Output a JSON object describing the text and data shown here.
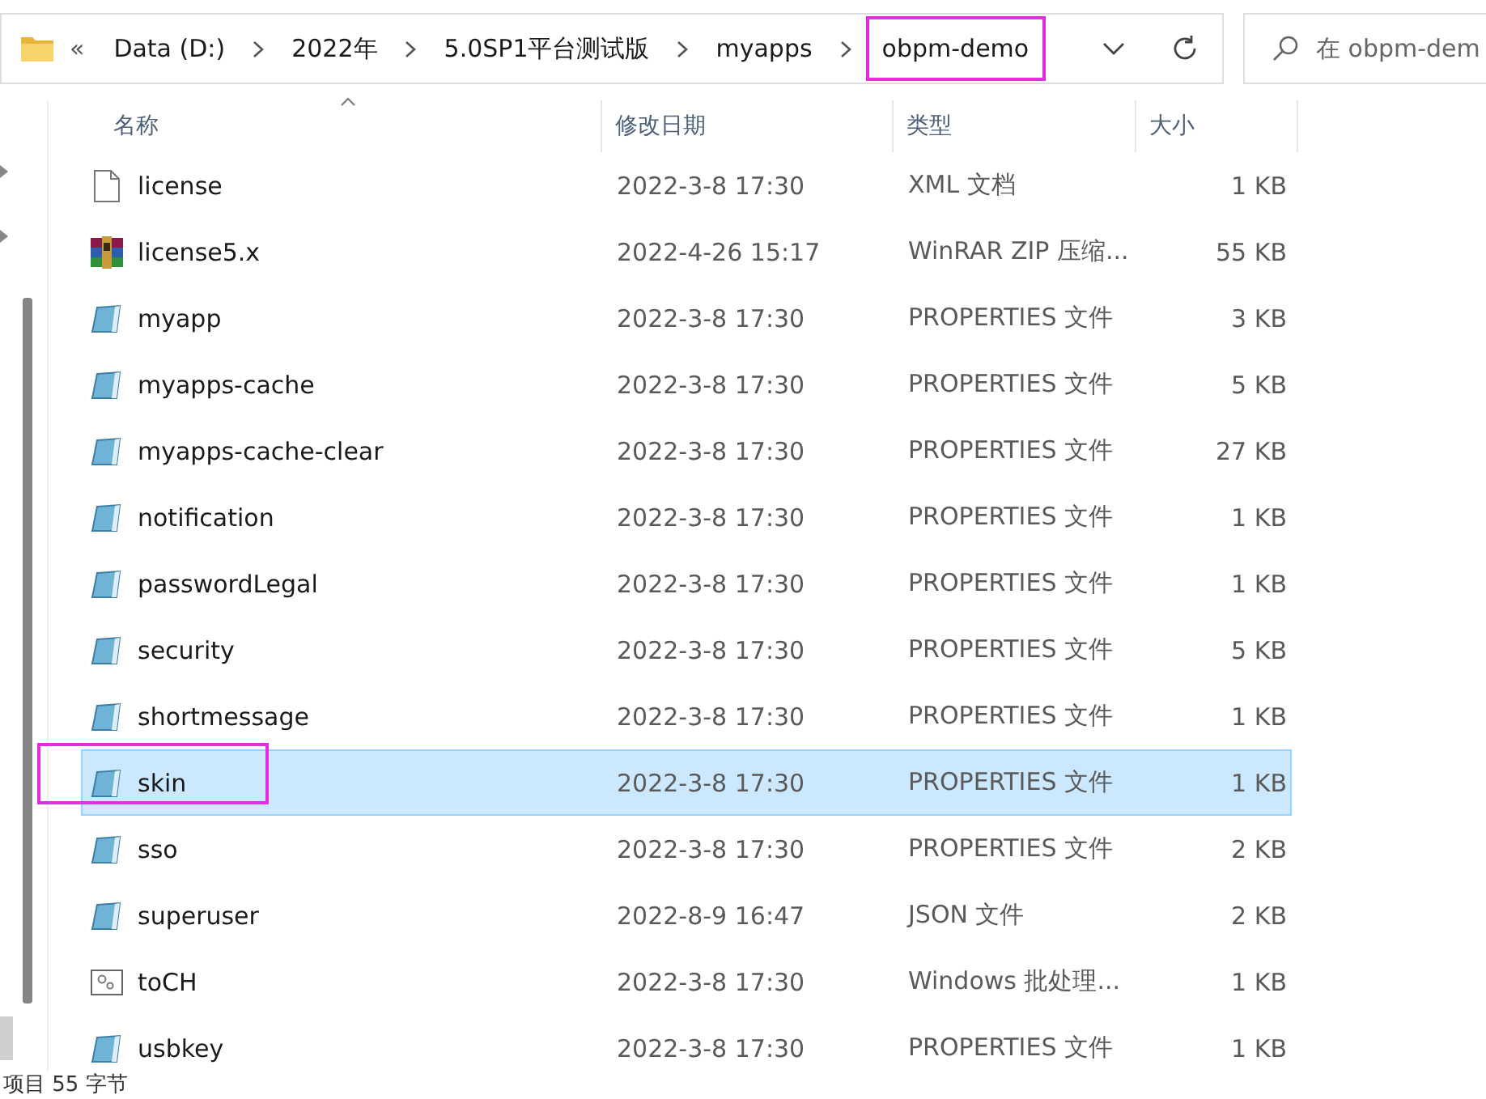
{
  "address_bar": {
    "overflow": "«",
    "path": [
      {
        "label": "Data (D:)",
        "highlighted": false
      },
      {
        "label": "2022年",
        "highlighted": false
      },
      {
        "label": "5.0SP1平台测试版",
        "highlighted": false
      },
      {
        "label": "myapps",
        "highlighted": false
      },
      {
        "label": "obpm-demo",
        "highlighted": true
      }
    ]
  },
  "search": {
    "placeholder": "在 obpm-dem"
  },
  "table": {
    "columns": [
      "名称",
      "修改日期",
      "类型",
      "大小"
    ],
    "rows": [
      {
        "kind": "file",
        "name": "license",
        "date": "2022-3-8 17:30",
        "type": "XML 文档",
        "size": "1 KB",
        "selected": false,
        "highlighted": false
      },
      {
        "kind": "archive",
        "name": "license5.x",
        "date": "2022-4-26 15:17",
        "type": "WinRAR ZIP 压缩...",
        "size": "55 KB",
        "selected": false,
        "highlighted": false
      },
      {
        "kind": "properties",
        "name": "myapp",
        "date": "2022-3-8 17:30",
        "type": "PROPERTIES 文件",
        "size": "3 KB",
        "selected": false,
        "highlighted": false
      },
      {
        "kind": "properties",
        "name": "myapps-cache",
        "date": "2022-3-8 17:30",
        "type": "PROPERTIES 文件",
        "size": "5 KB",
        "selected": false,
        "highlighted": false
      },
      {
        "kind": "properties",
        "name": "myapps-cache-clear",
        "date": "2022-3-8 17:30",
        "type": "PROPERTIES 文件",
        "size": "27 KB",
        "selected": false,
        "highlighted": false
      },
      {
        "kind": "properties",
        "name": "notification",
        "date": "2022-3-8 17:30",
        "type": "PROPERTIES 文件",
        "size": "1 KB",
        "selected": false,
        "highlighted": false
      },
      {
        "kind": "properties",
        "name": "passwordLegal",
        "date": "2022-3-8 17:30",
        "type": "PROPERTIES 文件",
        "size": "1 KB",
        "selected": false,
        "highlighted": false
      },
      {
        "kind": "properties",
        "name": "security",
        "date": "2022-3-8 17:30",
        "type": "PROPERTIES 文件",
        "size": "5 KB",
        "selected": false,
        "highlighted": false
      },
      {
        "kind": "properties",
        "name": "shortmessage",
        "date": "2022-3-8 17:30",
        "type": "PROPERTIES 文件",
        "size": "1 KB",
        "selected": false,
        "highlighted": false
      },
      {
        "kind": "properties",
        "name": "skin",
        "date": "2022-3-8 17:30",
        "type": "PROPERTIES 文件",
        "size": "1 KB",
        "selected": true,
        "highlighted": true
      },
      {
        "kind": "properties",
        "name": "sso",
        "date": "2022-3-8 17:30",
        "type": "PROPERTIES 文件",
        "size": "2 KB",
        "selected": false,
        "highlighted": false
      },
      {
        "kind": "properties",
        "name": "superuser",
        "date": "2022-8-9 16:47",
        "type": "JSON 文件",
        "size": "2 KB",
        "selected": false,
        "highlighted": false
      },
      {
        "kind": "batch",
        "name": "toCH",
        "date": "2022-3-8 17:30",
        "type": "Windows 批处理...",
        "size": "1 KB",
        "selected": false,
        "highlighted": false
      },
      {
        "kind": "properties",
        "name": "usbkey",
        "date": "2022-3-8 17:30",
        "type": "PROPERTIES 文件",
        "size": "1 KB",
        "selected": false,
        "highlighted": false
      }
    ]
  },
  "status_bar": {
    "text": "项目 55 字节"
  }
}
